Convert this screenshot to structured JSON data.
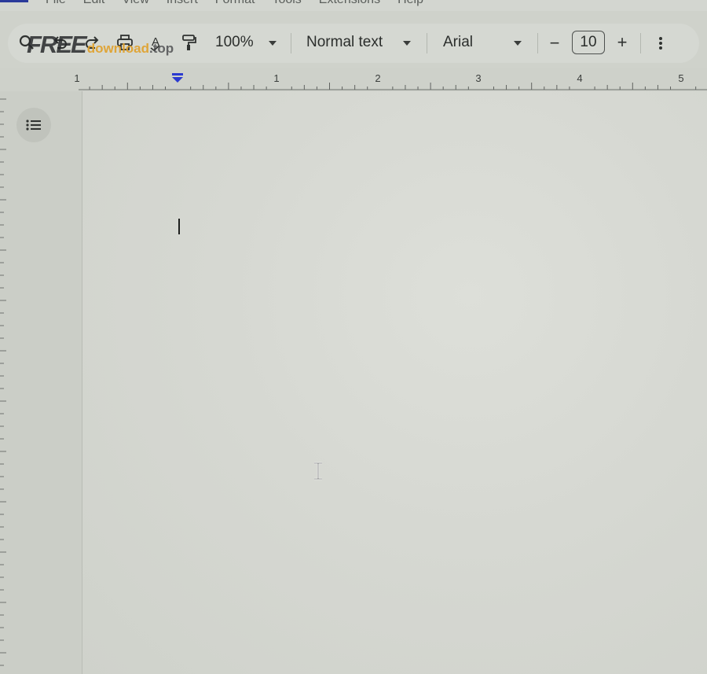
{
  "menubar": {
    "items": [
      {
        "label": "File"
      },
      {
        "label": "Edit"
      },
      {
        "label": "View"
      },
      {
        "label": "Insert"
      },
      {
        "label": "Format"
      },
      {
        "label": "Tools"
      },
      {
        "label": "Extensions"
      },
      {
        "label": "Help"
      }
    ]
  },
  "watermark": {
    "part1": "FREE",
    "part2": "download",
    "part3": ".top"
  },
  "toolbar": {
    "icons": [
      "search-icon",
      "undo-icon",
      "redo-icon",
      "print-icon",
      "spellcheck-icon",
      "paint-format-icon"
    ],
    "zoom": "100%",
    "paragraph_style": "Normal text",
    "font": "Arial",
    "font_size": "10",
    "decrease_label": "−",
    "increase_label": "+"
  },
  "ruler": {
    "labels": [
      "1",
      "1",
      "2",
      "3",
      "4",
      "5"
    ],
    "indent_marker_color": "#2b3ad0"
  },
  "sidebar": {
    "outline_icon": "outline-list-icon"
  },
  "colors": {
    "page": "#d9dbd5",
    "toolbar": "#d5d8d2",
    "accent": "#2b3ad0"
  }
}
